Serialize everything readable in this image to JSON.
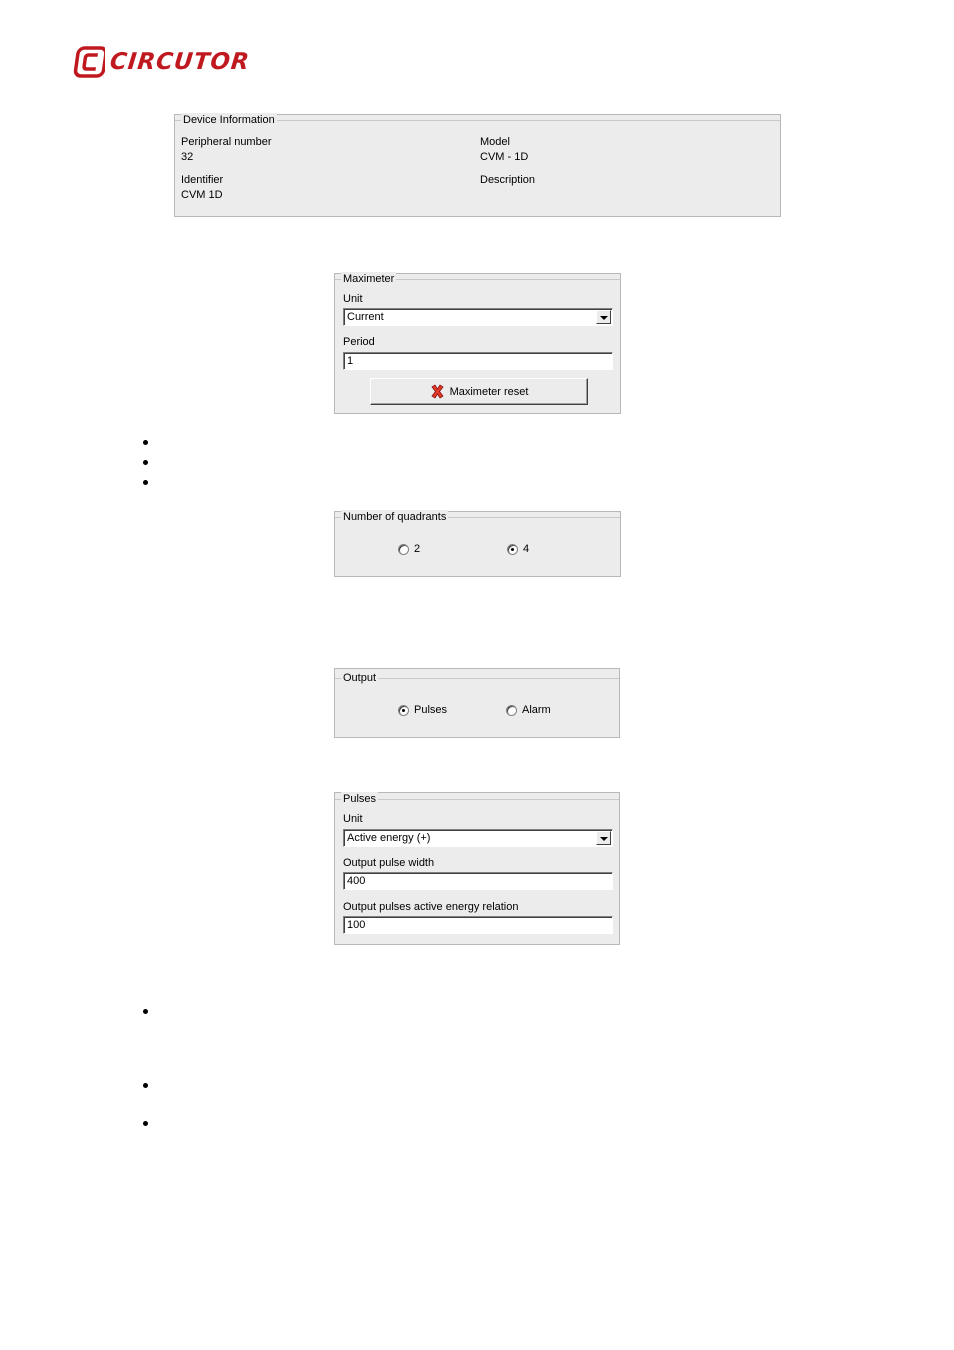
{
  "brand": {
    "name": "CIRCUTOR",
    "color": "#c0181f"
  },
  "device_info": {
    "title": "Device Information",
    "peripheral_label": "Peripheral number",
    "peripheral_value": "32",
    "model_label": "Model",
    "model_value": "CVM - 1D",
    "identifier_label": "Identifier",
    "identifier_value": "CVM 1D",
    "description_label": "Description"
  },
  "maximeter": {
    "title": "Maximeter",
    "unit_label": "Unit",
    "unit_value": "Current",
    "period_label": "Period",
    "period_value": "1",
    "reset_label": "Maximeter reset",
    "reset_icon": "red-x-icon"
  },
  "quadrants": {
    "title": "Number of quadrants",
    "options": [
      {
        "label": "2",
        "selected": false
      },
      {
        "label": "4",
        "selected": true
      }
    ]
  },
  "output": {
    "title": "Output",
    "options": [
      {
        "label": "Pulses",
        "selected": true
      },
      {
        "label": "Alarm",
        "selected": false
      }
    ]
  },
  "pulses": {
    "title": "Pulses",
    "unit_label": "Unit",
    "unit_value": "Active energy (+)",
    "width_label": "Output pulse width",
    "width_value": "400",
    "relation_label": "Output pulses active energy relation",
    "relation_value": "100"
  }
}
